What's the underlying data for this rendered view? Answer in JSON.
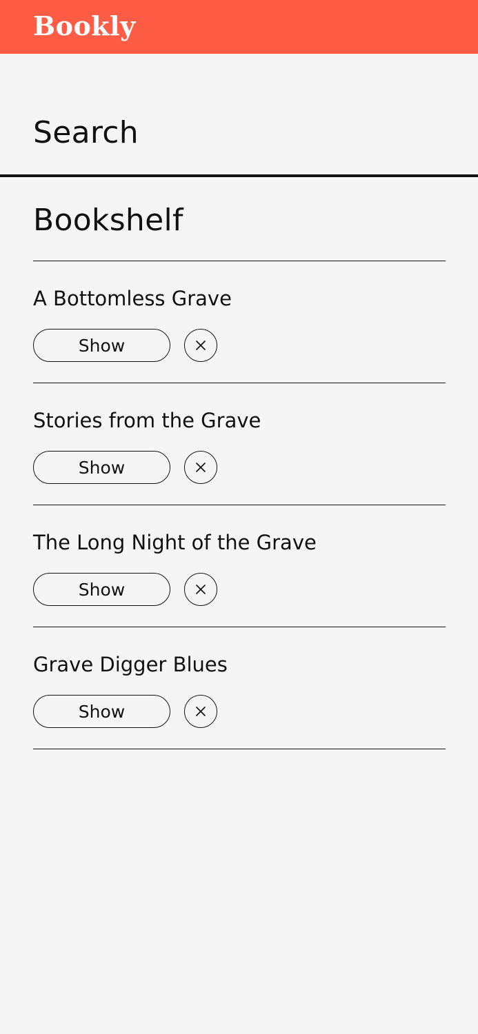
{
  "app": {
    "name": "Bookly"
  },
  "colors": {
    "brand": "#ff5c46",
    "background": "#f5f5f5",
    "text": "#111111"
  },
  "nav": {
    "search_label": "Search"
  },
  "bookshelf": {
    "title": "Bookshelf",
    "show_label": "Show",
    "remove_icon": "close-icon",
    "books": [
      {
        "title": "A Bottomless Grave"
      },
      {
        "title": "Stories from the Grave"
      },
      {
        "title": "The Long Night of the Grave"
      },
      {
        "title": "Grave Digger Blues"
      }
    ]
  }
}
